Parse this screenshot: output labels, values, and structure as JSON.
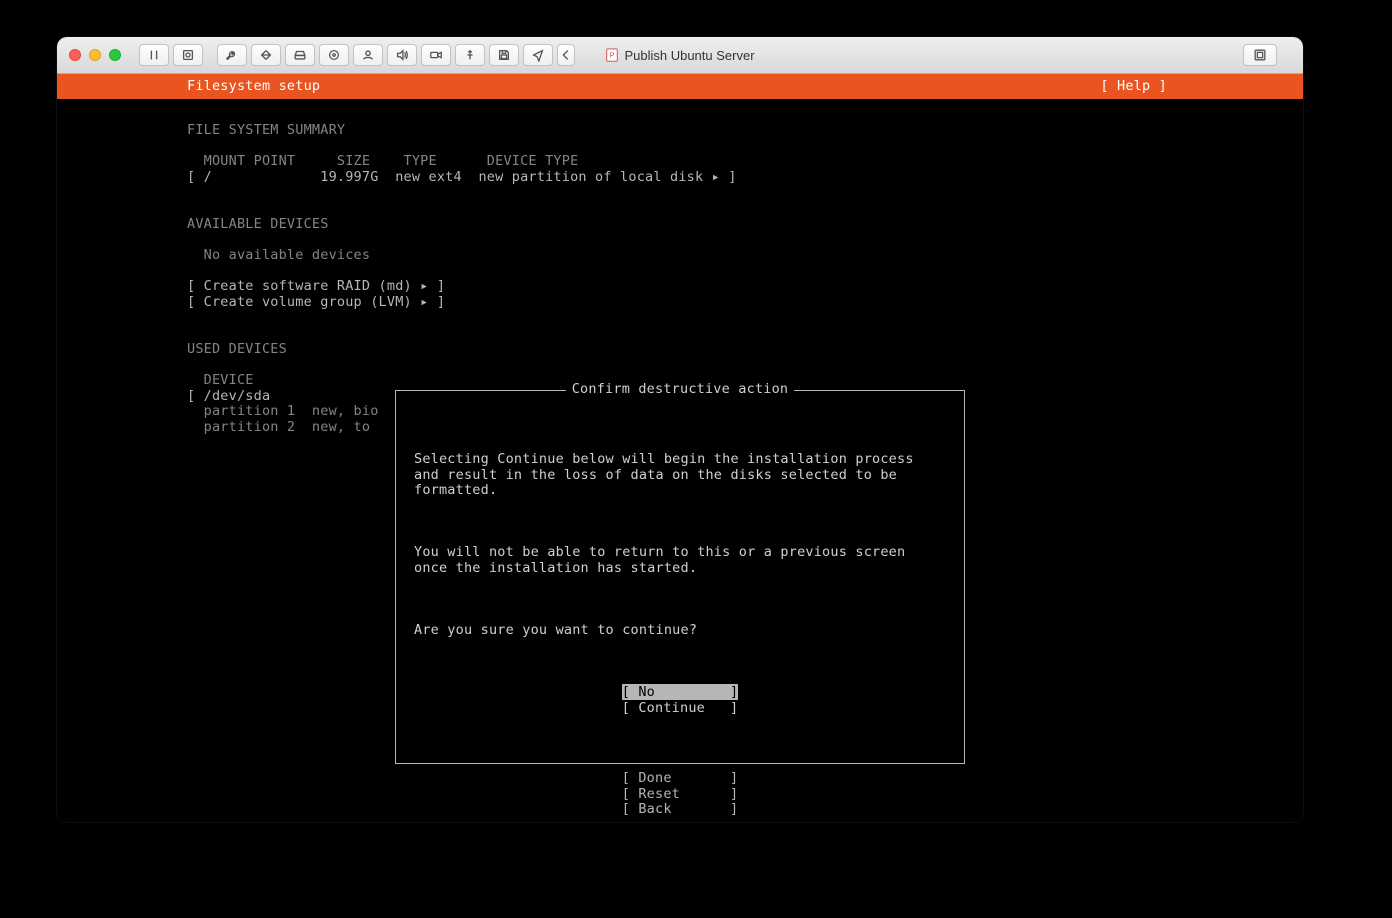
{
  "window_title": "Publish Ubuntu Server",
  "header": {
    "title": "Filesystem setup",
    "help": "[ Help ]"
  },
  "fs_summary": {
    "heading": "FILE SYSTEM SUMMARY",
    "cols": "  MOUNT POINT     SIZE    TYPE      DEVICE TYPE",
    "row": "[ /             19.997G  new ext4  new partition of local disk ▸ ]"
  },
  "available": {
    "heading": "AVAILABLE DEVICES",
    "none": "  No available devices",
    "raid": "[ Create software RAID (md) ▸ ]",
    "lvm": "[ Create volume group (LVM) ▸ ]"
  },
  "used": {
    "heading": "USED DEVICES",
    "cols": "  DEVICE",
    "dev": "[ /dev/sda",
    "p1": "  partition 1  new, bio",
    "p2": "  partition 2  new, to"
  },
  "dialog": {
    "title": "Confirm destructive action",
    "p1": "Selecting Continue below will begin the installation process and result in the loss of data on the disks selected to be formatted.",
    "p2": "You will not be able to return to this or a previous screen once the installation has started.",
    "p3": "Are you sure you want to continue?",
    "no": "[ No         ]",
    "continue": "[ Continue   ]"
  },
  "footer": {
    "done": "[ Done       ]",
    "reset": "[ Reset      ]",
    "back": "[ Back       ]"
  }
}
